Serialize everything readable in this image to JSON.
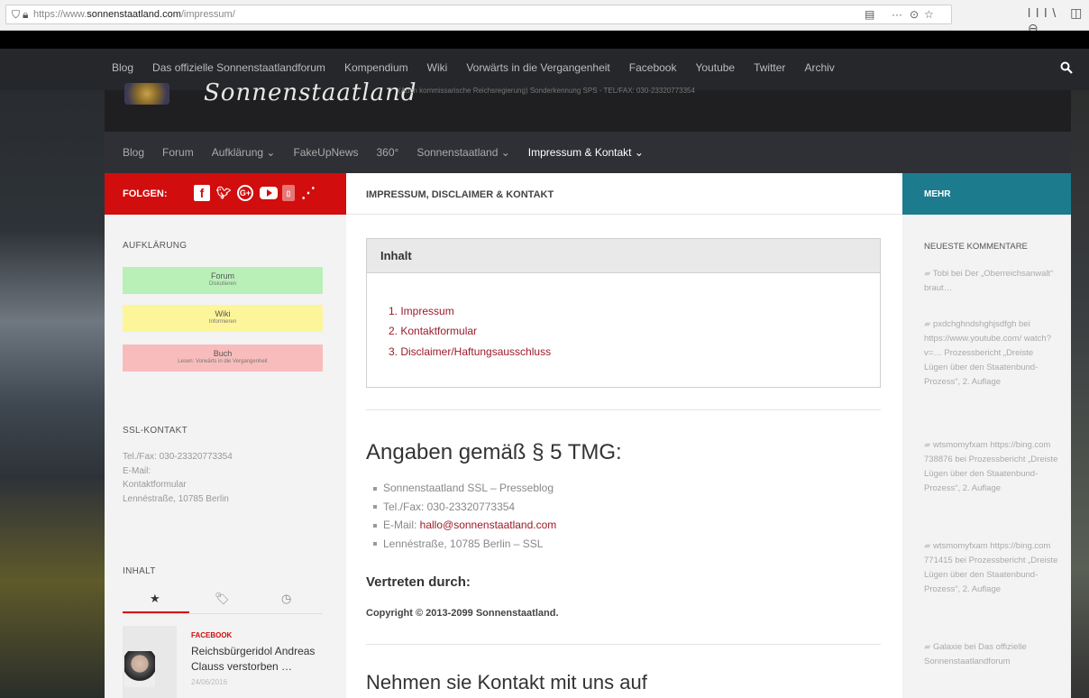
{
  "browser": {
    "url_prefix": "https://www.",
    "url_domain": "sonnenstaatland.com",
    "url_path": "/impressum/",
    "right_icons": "lll\\ ◫ ⊖"
  },
  "topnav": {
    "items": [
      "Blog",
      "Das offizielle Sonnenstaatlandforum",
      "Kompendium",
      "Wiki",
      "Vorwärts in die Vergangenheit",
      "Facebook",
      "Youtube",
      "Twitter",
      "Archiv"
    ]
  },
  "header": {
    "logo_text": "Sonnenstaatland",
    "tagline": "(Auch kommissarische Reichsregierung) Sonderkennung SPS - TEL/FAX: 030-23320773354"
  },
  "mainnav": {
    "items": [
      "Blog",
      "Forum",
      "Aufklärung ⌄",
      "FakeUpNews",
      "360°",
      "Sonnenstaatland ⌄",
      "Impressum & Kontakt ⌄"
    ]
  },
  "left": {
    "follow_label": "FOLGEN:",
    "aufklaerung_heading": "AUFKLÄRUNG",
    "buttons": [
      {
        "title": "Forum",
        "sub": "Diskutieren",
        "color": "#b8f0b8"
      },
      {
        "title": "Wiki",
        "sub": "Informieren",
        "color": "#fdf59a"
      },
      {
        "title": "Buch",
        "sub": "Lesen: Vorwärts in die Vergangenheit",
        "color": "#f9bcbc"
      }
    ],
    "ssl_heading": "SSL-KONTAKT",
    "ssl_lines": [
      "Tel./Fax: 030-23320773354",
      "E-Mail:",
      "Kontaktformular",
      "Lennéstraße, 10785 Berlin"
    ],
    "inhalt_heading": "INHALT",
    "post_category": "FACEBOOK",
    "post_title": "Reichsbürgeridol Andreas Clauss verstorben …",
    "post_date": "24/06/2016"
  },
  "center": {
    "page_heading": "IMPRESSUM, DISCLAIMER & KONTAKT",
    "toc_title": "Inhalt",
    "toc_items": [
      "1. Impressum",
      "2. Kontaktformular",
      "3. Disclaimer/Haftungsausschluss"
    ],
    "h_angaben": "Angaben gemäß § 5 TMG:",
    "list": [
      "Sonnenstaatland SSL – Presseblog",
      "Tel./Fax: 030-23320773354",
      "E-Mail: ",
      "Lennéstraße, 10785 Berlin – SSL"
    ],
    "email": "hallo@sonnenstaatland.com",
    "h_vertreten": "Vertreten durch:",
    "copyright": "Copyright © 2013-2099 Sonnenstaatland.",
    "h_kontakt": "Nehmen sie Kontakt mit uns auf"
  },
  "right": {
    "mehr": "MEHR",
    "heading": "NEUESTE KOMMENTARE",
    "comments": [
      "Tobi bei Der „Oberreichsanwalt“ braut…",
      "pxdchghndshghjsdfgh bei https://www.youtube.com/ watch?v=… Prozessbericht „Dreiste Lügen über den Staatenbund-Prozess“, 2. Auflage",
      "wtsmomyfxam https://bing.com 738876 bei Prozessbericht „Dreiste Lügen über den Staatenbund-Prozess“, 2. Auflage",
      "wtsmomyfxam https://bing.com 771415 bei Prozessbericht „Dreiste Lügen über den Staatenbund-Prozess“, 2. Auflage",
      "Galaxie bei Das offizielle Sonnenstaatlandforum"
    ]
  }
}
